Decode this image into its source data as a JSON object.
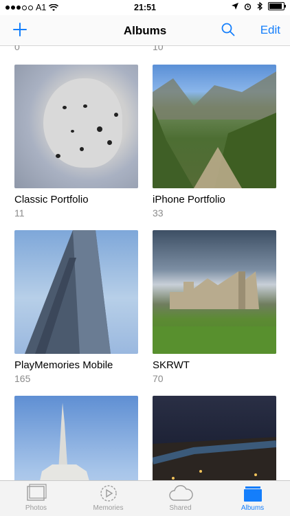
{
  "status_bar": {
    "carrier": "A1",
    "time": "21:51"
  },
  "nav": {
    "title": "Albums",
    "edit_label": "Edit"
  },
  "top_counts": [
    "0",
    "10"
  ],
  "albums": [
    {
      "name": "Classic Portfolio",
      "count": "11"
    },
    {
      "name": "iPhone Portfolio",
      "count": "33"
    },
    {
      "name": "PlayMemories Mobile",
      "count": "165"
    },
    {
      "name": "SKRWT",
      "count": "70"
    },
    {
      "name": "",
      "count": ""
    },
    {
      "name": "",
      "count": ""
    }
  ],
  "tabs": [
    {
      "label": "Photos",
      "icon": "photos-icon"
    },
    {
      "label": "Memories",
      "icon": "memories-icon"
    },
    {
      "label": "Shared",
      "icon": "cloud-icon"
    },
    {
      "label": "Albums",
      "icon": "albums-icon"
    }
  ],
  "active_tab": "Albums",
  "accent_color": "#147efb"
}
